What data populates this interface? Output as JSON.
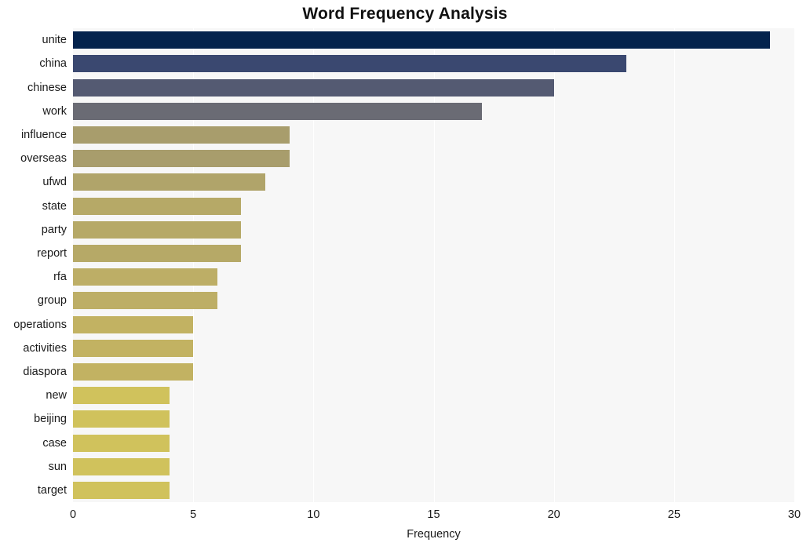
{
  "chart_data": {
    "type": "bar",
    "orientation": "horizontal",
    "title": "Word Frequency Analysis",
    "xlabel": "Frequency",
    "ylabel": "",
    "categories": [
      "unite",
      "china",
      "chinese",
      "work",
      "influence",
      "overseas",
      "ufwd",
      "state",
      "party",
      "report",
      "rfa",
      "group",
      "operations",
      "activities",
      "diaspora",
      "new",
      "beijing",
      "case",
      "sun",
      "target"
    ],
    "values": [
      29,
      23,
      20,
      17,
      9,
      9,
      8,
      7,
      7,
      7,
      6,
      6,
      5,
      5,
      5,
      4,
      4,
      4,
      4,
      4
    ],
    "bar_colors": [
      "#04234d",
      "#3a4870",
      "#545a72",
      "#6a6b74",
      "#a89d6c",
      "#a89d6c",
      "#b0a46a",
      "#b6a967",
      "#b6a967",
      "#b6a967",
      "#bdae66",
      "#bdae66",
      "#c2b262",
      "#c2b262",
      "#c2b262",
      "#d0c25c",
      "#d0c25c",
      "#d0c25c",
      "#d0c25c",
      "#d0c25c"
    ],
    "xlim": [
      0,
      30
    ],
    "xticks": [
      0,
      5,
      10,
      15,
      20,
      25,
      30
    ],
    "xtick_labels": [
      "0",
      "5",
      "10",
      "15",
      "20",
      "25",
      "30"
    ],
    "grid": true,
    "grid_axis": "x",
    "grid_color": "#ffffff",
    "plot_background": "#f7f7f7",
    "figure_background": "#ffffff",
    "legend": null
  }
}
